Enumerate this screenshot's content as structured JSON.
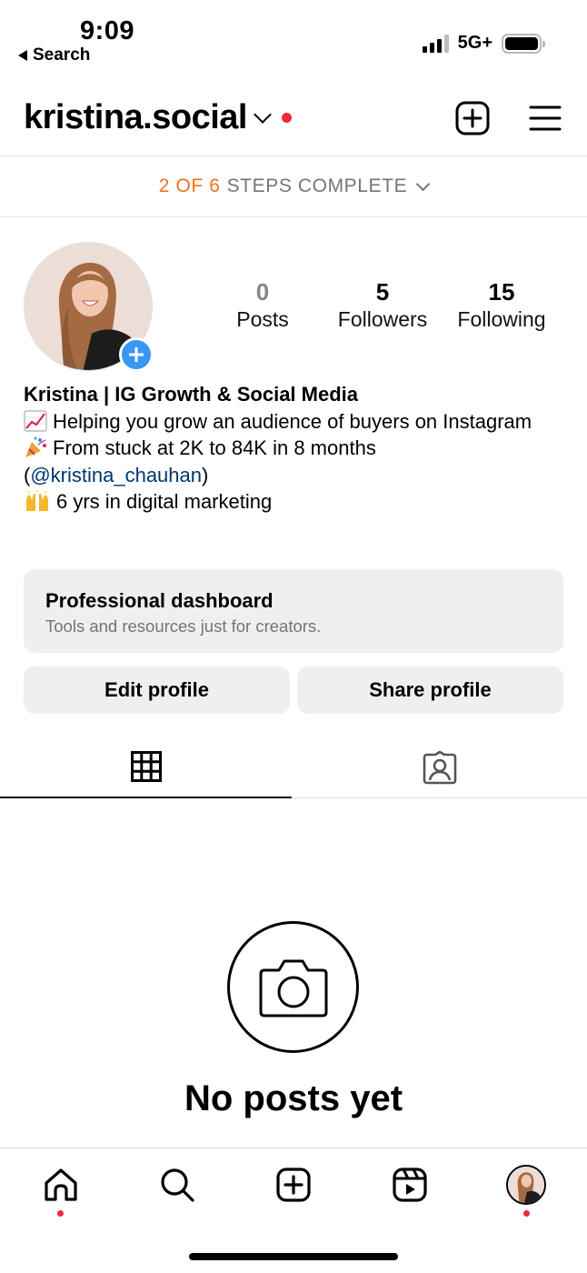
{
  "status_bar": {
    "time": "9:09",
    "back_label": "Search",
    "network": "5G+"
  },
  "header": {
    "username": "kristina.social"
  },
  "steps": {
    "progress": "2 OF 6",
    "label": "STEPS COMPLETE"
  },
  "stats": [
    {
      "value": "0",
      "label": "Posts"
    },
    {
      "value": "5",
      "label": "Followers"
    },
    {
      "value": "15",
      "label": "Following"
    }
  ],
  "bio": {
    "name": "Kristina | IG Growth & Social Media",
    "line1": "Helping you grow an audience of buyers on Instagram",
    "line2": "From stuck at 2K to 84K in 8 months",
    "mention_open": "(",
    "mention": "@kristina_chauhan",
    "mention_close": ")",
    "line3": "6 yrs in digital marketing"
  },
  "dashboard": {
    "title": "Professional dashboard",
    "subtitle": "Tools and resources just for creators."
  },
  "buttons": {
    "edit": "Edit profile",
    "share": "Share profile"
  },
  "empty": {
    "title": "No posts yet"
  },
  "icons": {
    "status": [
      "signal-icon",
      "battery-icon"
    ],
    "header": [
      "new-post-icon",
      "menu-icon"
    ],
    "tabs": [
      "grid-icon",
      "tagged-icon"
    ],
    "nav": [
      "home-icon",
      "search-icon",
      "create-icon",
      "reels-icon",
      "profile-avatar"
    ]
  },
  "colors": {
    "accent_orange": "#f0701e",
    "notification_red": "#ed2a3a",
    "add_blue": "#3897f0",
    "mention_blue": "#00376b"
  }
}
